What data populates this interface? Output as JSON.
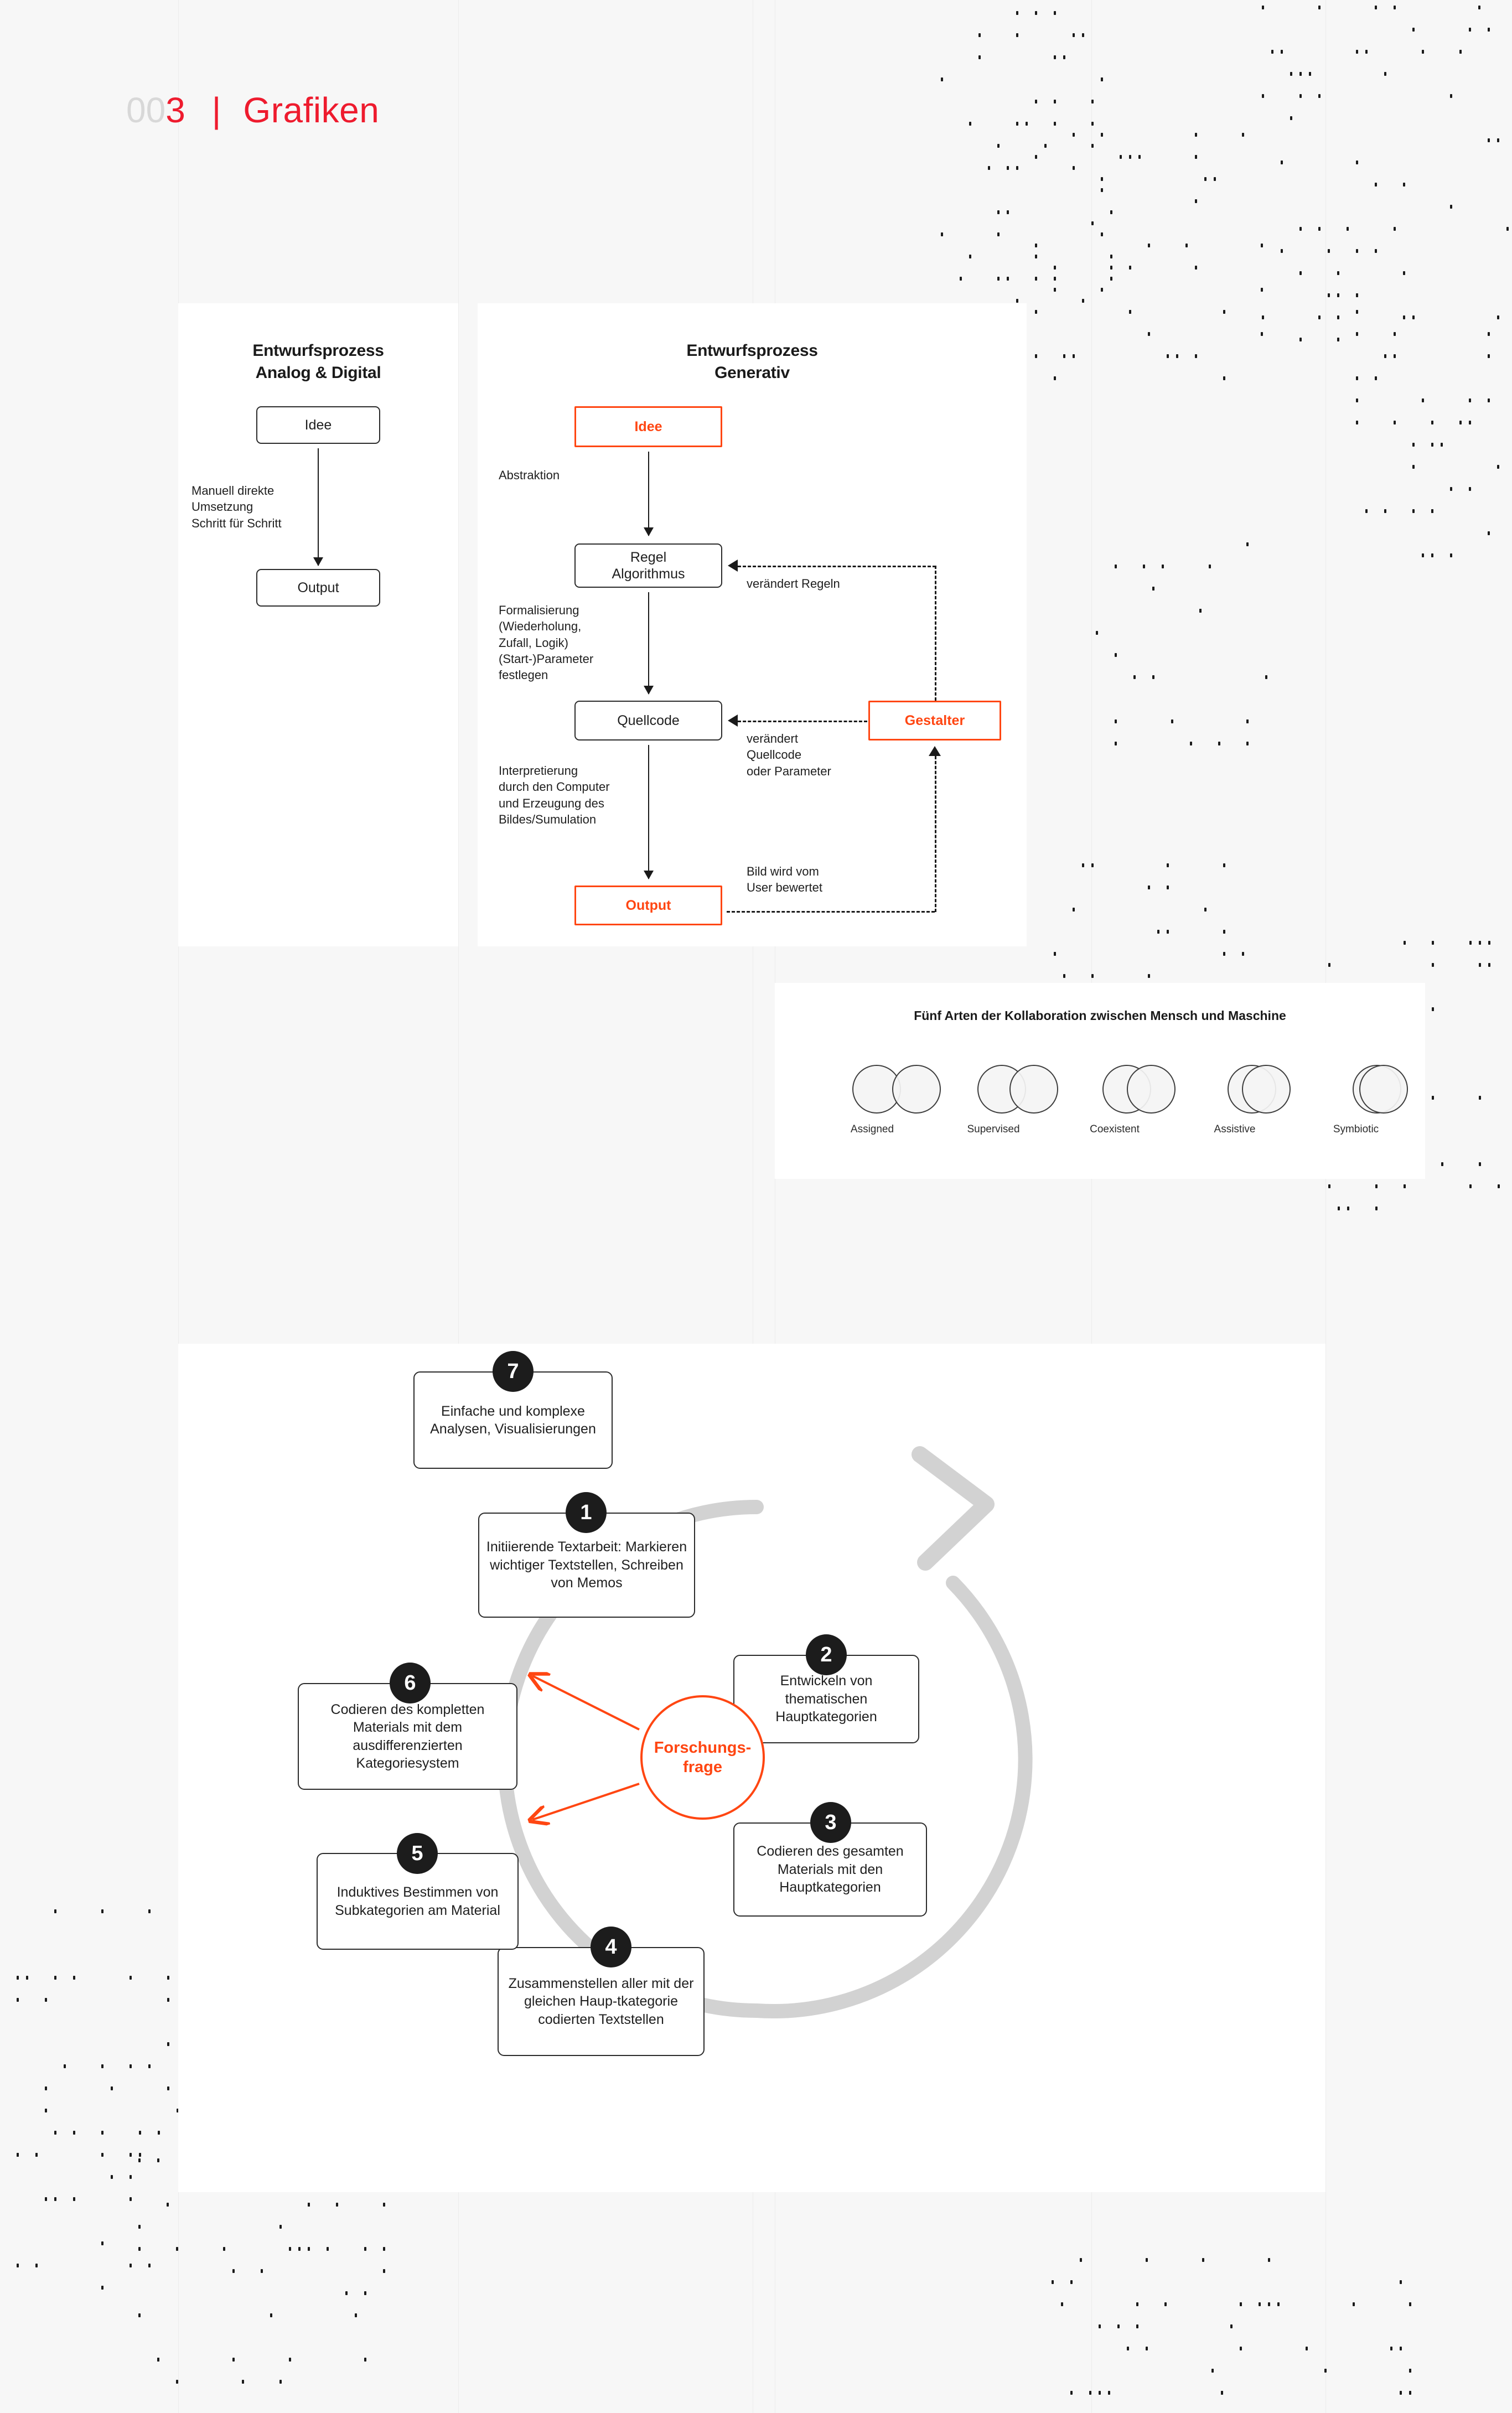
{
  "header": {
    "number_prefix": "00",
    "number_active": "3",
    "separator": "|",
    "title": "Grafiken"
  },
  "colors": {
    "accent_red": "#ee1b2e",
    "accent_orange": "#ff4612",
    "ink": "#1a1a1a",
    "muted": "#d8d8d8",
    "panel_bg": "#ffffff",
    "page_bg": "#f7f7f7",
    "cycle_ring": "#d2d2d2"
  },
  "panel_analog": {
    "title_line1": "Entwurfsprozess",
    "title_line2": "Analog & Digital",
    "boxes": [
      {
        "label": "Idee",
        "accent": false
      },
      {
        "label": "Output",
        "accent": false
      }
    ],
    "edge_label": "Manuell direkte\nUmsetzung\nSchritt für Schritt"
  },
  "panel_generativ": {
    "title_line1": "Entwurfsprozess",
    "title_line2": "Generativ",
    "boxes": [
      {
        "label": "Idee",
        "accent": true
      },
      {
        "label": "Regel\nAlgorithmus",
        "accent": false
      },
      {
        "label": "Quellcode",
        "accent": false
      },
      {
        "label": "Output",
        "accent": true
      },
      {
        "label": "Gestalter",
        "accent": true
      }
    ],
    "edge_labels": {
      "abstraktion": "Abstraktion",
      "formalisierung": "Formalisierung\n(Wiederholung,\nZufall, Logik)\n(Start-)Parameter\nfestlegen",
      "interpretierung": "Interpretierung\ndurch den Computer\nund Erzeugung des\nBildes/Sumulation",
      "veraendert_regeln": "verändert Regeln",
      "veraendert_quellcode": "verändert\nQuellcode\noder Parameter",
      "bild_bewertet": "Bild wird vom\nUser bewertet"
    }
  },
  "panel_collab": {
    "title": "Fünf Arten der Kollaboration zwischen Mensch und Maschine",
    "items": [
      {
        "label": "Assigned",
        "overlap": 16
      },
      {
        "label": "Supervised",
        "overlap": 30
      },
      {
        "label": "Coexistent",
        "overlap": 44
      },
      {
        "label": "Assistive",
        "overlap": 62
      },
      {
        "label": "Symbiotic",
        "overlap": 76
      }
    ]
  },
  "panel_cycle": {
    "center_line1": "Forschungs-",
    "center_line2": "frage",
    "steps": [
      {
        "number": "1",
        "text": "Initiierende Textarbeit: Markieren wichtiger Textstellen, Schreiben von Memos"
      },
      {
        "number": "2",
        "text": "Entwickeln von thematischen Hauptkategorien"
      },
      {
        "number": "3",
        "text": "Codieren des gesamten Materials mit den Hauptkategorien"
      },
      {
        "number": "4",
        "text": "Zusammenstellen aller mit der gleichen Haup-tkategorie codierten Textstellen"
      },
      {
        "number": "5",
        "text": "Induktives Bestimmen von Subkategorien am Material"
      },
      {
        "number": "6",
        "text": "Codieren des kompletten Materials mit dem ausdifferenzierten Kategoriesystem"
      },
      {
        "number": "7",
        "text": "Einfache und komplexe Analysen, Visualisierungen"
      }
    ]
  }
}
